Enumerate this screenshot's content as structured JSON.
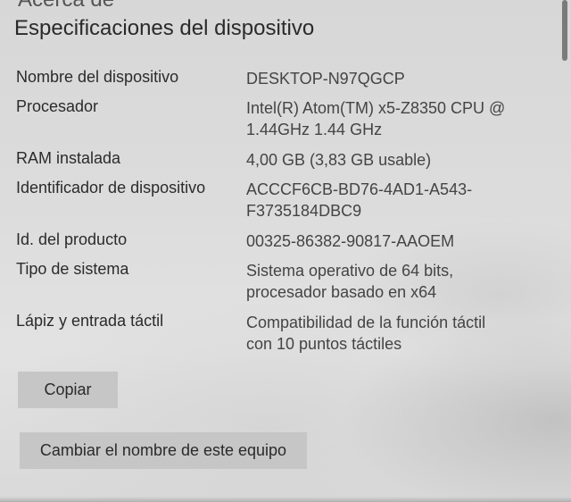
{
  "header": {
    "partial_title": "Acerca de",
    "section_title": "Especificaciones del dispositivo"
  },
  "specs": [
    {
      "label": "Nombre del dispositivo",
      "value": "DESKTOP-N97QGCP"
    },
    {
      "label": "Procesador",
      "value": "Intel(R) Atom(TM) x5-Z8350  CPU @\n1.44GHz   1.44 GHz"
    },
    {
      "label": "RAM instalada",
      "value": "4,00 GB (3,83 GB usable)"
    },
    {
      "label": "Identificador de dispositivo",
      "value": "ACCCF6CB-BD76-4AD1-A543-\nF3735184DBC9"
    },
    {
      "label": "Id. del producto",
      "value": "00325-86382-90817-AAOEM"
    },
    {
      "label": "Tipo de sistema",
      "value": "Sistema operativo de 64 bits,\nprocesador basado en x64"
    },
    {
      "label": "Lápiz y entrada táctil",
      "value": "Compatibilidad de la función táctil\ncon 10 puntos táctiles"
    }
  ],
  "buttons": {
    "copy_label": "Copiar",
    "rename_label": "Cambiar el nombre de este equipo"
  }
}
